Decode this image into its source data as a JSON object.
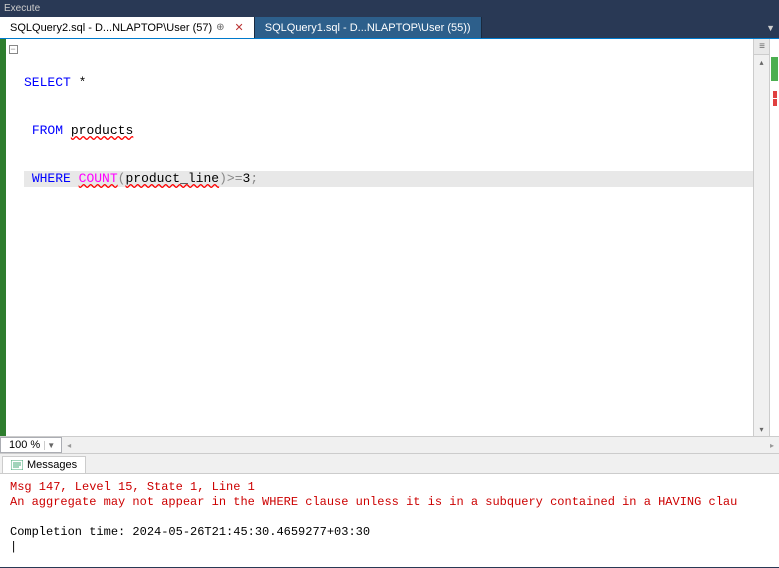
{
  "toolbar": {
    "execute_label": "Execute"
  },
  "tabs": [
    {
      "label": "SQLQuery2.sql - D...NLAPTOP\\User (57)",
      "active": true,
      "pinned": true
    },
    {
      "label": "SQLQuery1.sql - D...NLAPTOP\\User (55))",
      "active": false,
      "pinned": false
    }
  ],
  "code": {
    "line1": {
      "select": "SELECT",
      "star": " *"
    },
    "line2": {
      "from": "FROM",
      "space": " ",
      "products": "products"
    },
    "line3": {
      "where": "WHERE",
      "sp1": " ",
      "count": "COUNT",
      "lp": "(",
      "col": "product_line",
      "rp": ")",
      "op": ">=",
      "num": "3",
      "semi": ";"
    }
  },
  "zoom": {
    "value": "100 %"
  },
  "results": {
    "tab_label": "Messages"
  },
  "messages": {
    "err_header": "Msg 147, Level 15, State 1, Line 1",
    "err_body": "An aggregate may not appear in the WHERE clause unless it is in a subquery contained in a HAVING clau",
    "completion": "Completion time: 2024-05-26T21:45:30.4659277+03:30"
  }
}
